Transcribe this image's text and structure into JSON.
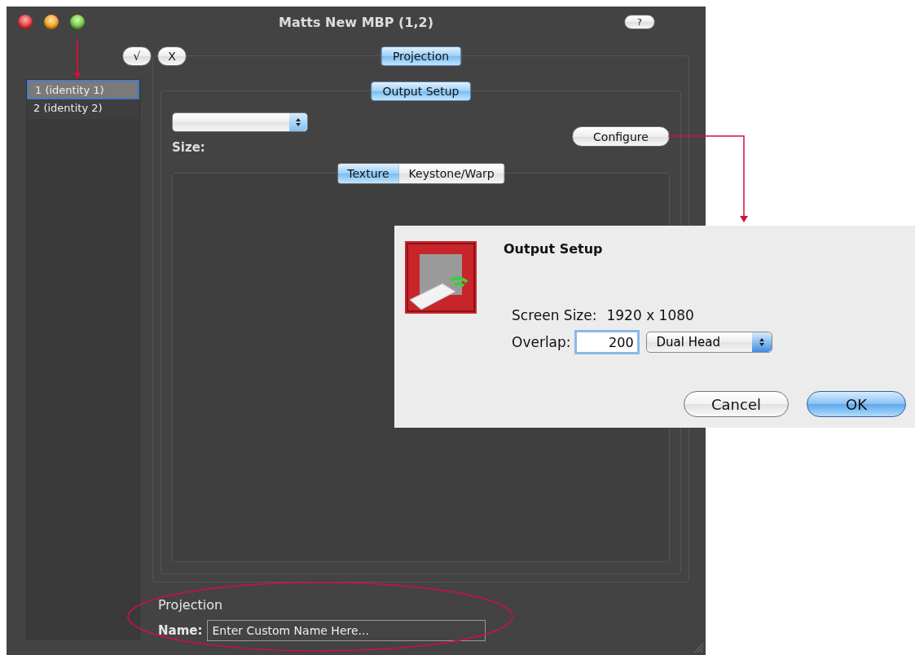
{
  "window": {
    "title": "Matts New MBP (1,2)",
    "help_button": "?"
  },
  "toolbar": {
    "confirm": "√",
    "cancel": "X"
  },
  "identities": [
    {
      "label": "1 (identity 1)",
      "selected": true
    },
    {
      "label": "2 (identity 2)",
      "selected": false
    }
  ],
  "projection": {
    "tab": "Projection",
    "output_setup": {
      "tab": "Output Setup",
      "size_label": "Size:",
      "configure_button": "Configure",
      "tabs": [
        {
          "label": "Texture",
          "selected": true
        },
        {
          "label": "Keystone/Warp",
          "selected": false
        }
      ]
    },
    "section_label": "Projection",
    "name_label": "Name:",
    "name_placeholder": "Enter Custom Name Here..."
  },
  "dialog": {
    "title": "Output Setup",
    "screen_size_label": "Screen Size:",
    "screen_size": "1920 x 1080",
    "overlap_label": "Overlap:",
    "overlap_value": "200",
    "mode": "Dual Head",
    "buttons": [
      {
        "label": "Cancel",
        "default": false
      },
      {
        "label": "OK",
        "default": true
      }
    ]
  }
}
